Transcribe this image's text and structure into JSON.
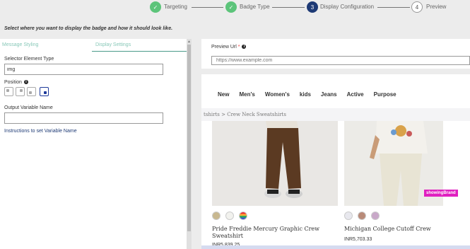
{
  "stepper": {
    "steps": [
      {
        "number": "1",
        "label": "Targeting",
        "state": "done"
      },
      {
        "number": "2",
        "label": "Badge Type",
        "state": "done"
      },
      {
        "number": "3",
        "label": "Display Configuration",
        "state": "active"
      },
      {
        "number": "4",
        "label": "Preview",
        "state": "pending"
      }
    ],
    "done_color": "#5cc47a",
    "active_color": "#1e3a75"
  },
  "instruction": "Select where you want to display the badge and how it should look like.",
  "left_panel": {
    "tabs": [
      "Message Styling",
      "Display Settings"
    ],
    "active_tab": "Display Settings",
    "selector_label": "Selector Element Type",
    "selector_value": "img",
    "position_label": "Position",
    "position_options": [
      "top-left",
      "top-right",
      "bottom-left",
      "bottom-right"
    ],
    "position_selected": "bottom-right",
    "output_label": "Output Variable Name",
    "output_value": "",
    "instructions_link": "Instructions to set Variable Name"
  },
  "right_panel": {
    "preview_label": "Preview Url",
    "required_mark": "*",
    "url_placeholder": "https://www.example.com"
  },
  "preview": {
    "nav": [
      "New",
      "Men's",
      "Women's",
      "kids",
      "Jeans",
      "Active",
      "Purpose"
    ],
    "breadcrumb": "tshirts  >  Crew Neck Sweatshirts",
    "products": [
      {
        "name_line1": "Pride Freddie Mercury Graphic Crew",
        "name_line2": "Sweatshirt",
        "price": "INR5,839.25"
      },
      {
        "name_line1": "Michigan College Cutoff Crew",
        "name_line2": "",
        "price": "INR5,703.33"
      }
    ],
    "badge_text": "showingBrand",
    "badge_color": "#e020c0"
  }
}
